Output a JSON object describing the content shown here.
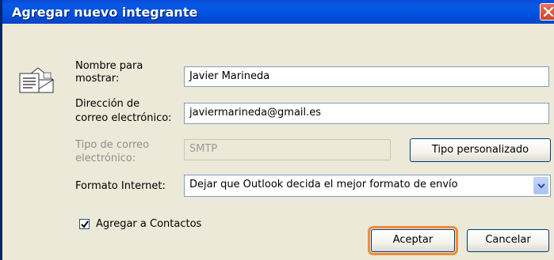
{
  "window": {
    "title": "Agregar nuevo integrante"
  },
  "form": {
    "display_name_label_line1": "Nombre para",
    "display_name_label_line2": "mostrar:",
    "display_name_value": "Javier Marineda",
    "email_label_line1": "Dirección de",
    "email_label_line2": "correo electrónico:",
    "email_value": "javiermarineda@gmail.es",
    "email_type_label_line1": "Tipo de correo",
    "email_type_label_line2": "electrónico:",
    "email_type_value": "SMTP",
    "custom_type_button": "Tipo personalizado",
    "internet_format_label": "Formato Internet:",
    "internet_format_value": "Dejar que Outlook decida el mejor formato de envío",
    "add_to_contacts_label": "Agregar a Contactos",
    "add_to_contacts_checked": true
  },
  "buttons": {
    "ok": "Aceptar",
    "cancel": "Cancelar"
  },
  "colors": {
    "titlebar": "#0053e1",
    "focus_outline": "#f28a3a",
    "dialog_bg": "#ece9d8"
  },
  "icons": {
    "dialog": "envelope-card-icon",
    "close": "close-icon",
    "dropdown": "chevron-down-icon",
    "check": "checkmark-icon"
  }
}
